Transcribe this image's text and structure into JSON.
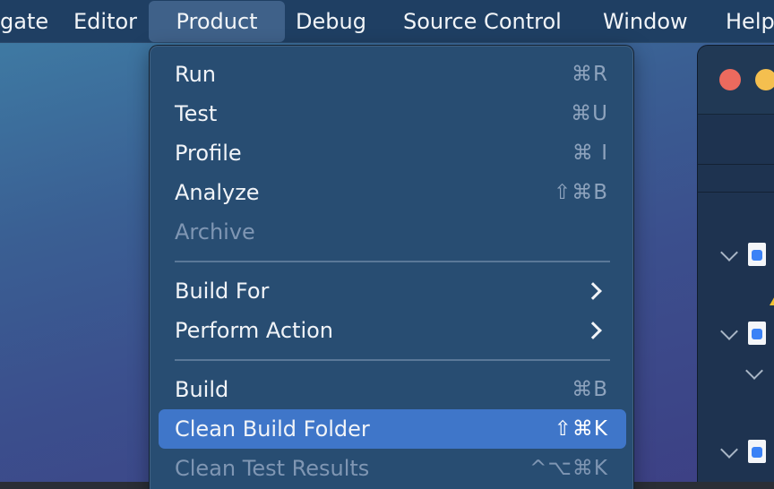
{
  "menubar": {
    "items": [
      {
        "label": "gate"
      },
      {
        "label": "Editor"
      },
      {
        "label": "Product"
      },
      {
        "label": "Debug"
      },
      {
        "label": "Source Control"
      },
      {
        "label": "Window"
      },
      {
        "label": "Help"
      }
    ],
    "active": "Product"
  },
  "menu": {
    "items": [
      {
        "label": "Run",
        "shortcut": "⌘R",
        "enabled": true
      },
      {
        "label": "Test",
        "shortcut": "⌘U",
        "enabled": true
      },
      {
        "label": "Profile",
        "shortcut": "⌘ I",
        "enabled": true
      },
      {
        "label": "Analyze",
        "shortcut": "⇧⌘B",
        "enabled": true
      },
      {
        "label": "Archive",
        "shortcut": "",
        "enabled": false
      },
      {
        "label": "Build For",
        "submenu": true,
        "enabled": true
      },
      {
        "label": "Perform Action",
        "submenu": true,
        "enabled": true
      },
      {
        "label": "Build",
        "shortcut": "⌘B",
        "enabled": true
      },
      {
        "label": "Clean Build Folder",
        "shortcut": "⇧⌘K",
        "enabled": true,
        "highlighted": true
      },
      {
        "label": "Clean Test Results",
        "shortcut": "^⌥⌘K",
        "enabled": false
      }
    ]
  },
  "colors": {
    "menu_background": "#284d72",
    "highlight": "#3f76c9",
    "menubar": "#1f3f63",
    "close_button": "#ec6a5e",
    "minimize_button": "#f4bf4f",
    "warning": "#f2c230"
  }
}
